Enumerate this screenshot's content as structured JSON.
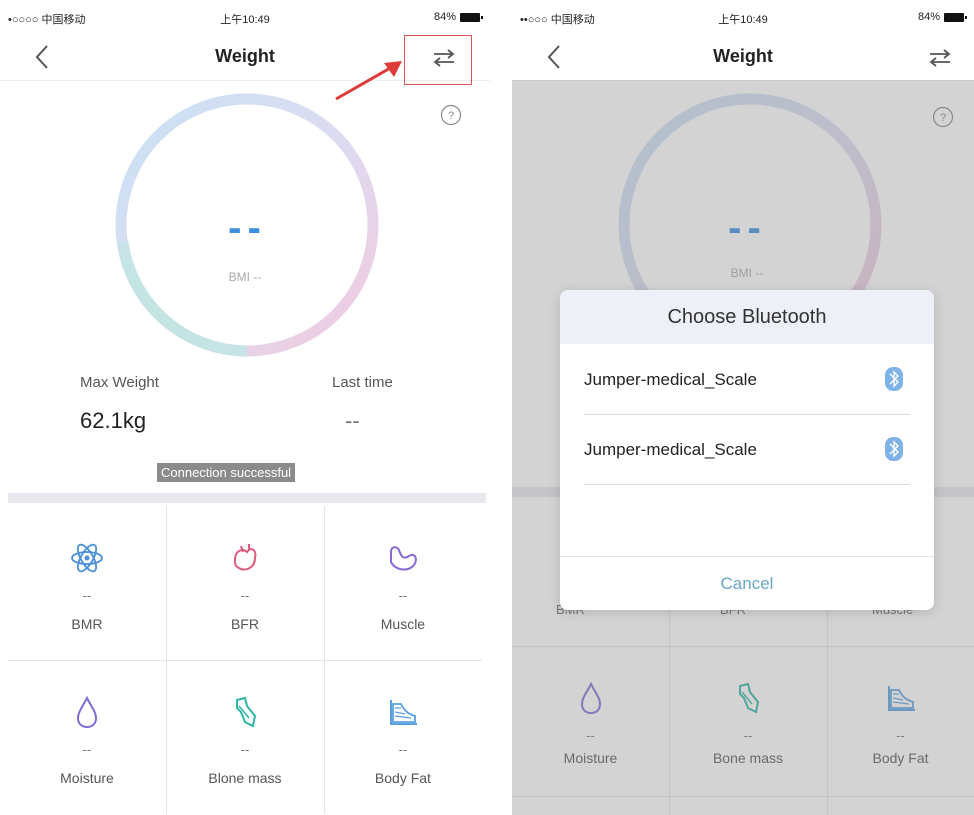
{
  "left": {
    "status": {
      "carrier": "•○○○○ 中国移动",
      "time": "上午10:49",
      "battery": "84%"
    },
    "nav": {
      "title": "Weight"
    },
    "gauge": {
      "value": "--",
      "bmi": "BMI --"
    },
    "stats": {
      "max_label": "Max Weight",
      "max_value": "62.1kg",
      "last_label": "Last time",
      "last_value": "--"
    },
    "connection": "Connection successful",
    "metrics": [
      {
        "name": "BMR",
        "value": "--",
        "icon": "atom-icon",
        "color": "#4a90d9"
      },
      {
        "name": "BFR",
        "value": "--",
        "icon": "body-fat-rate-icon",
        "color": "#e25a7a"
      },
      {
        "name": "Muscle",
        "value": "--",
        "icon": "muscle-icon",
        "color": "#8a6bd6"
      },
      {
        "name": "Moisture",
        "value": "--",
        "icon": "water-drop-icon",
        "color": "#7e6fd6"
      },
      {
        "name": "Blone mass",
        "value": "--",
        "icon": "bone-icon",
        "color": "#2fb5a5"
      },
      {
        "name": "Body Fat",
        "value": "--",
        "icon": "body-fat-chart-icon",
        "color": "#5aa0e0"
      }
    ]
  },
  "right": {
    "status": {
      "carrier": "••○○○ 中国移动",
      "time": "上午10:49",
      "battery": "84%"
    },
    "nav": {
      "title": "Weight"
    },
    "gauge": {
      "value": "--",
      "bmi": "BMI --"
    },
    "dialog": {
      "title": "Choose Bluetooth",
      "devices": [
        "Jumper-medical_Scale",
        "Jumper-medical_Scale"
      ],
      "cancel": "Cancel"
    },
    "partial_labels": [
      "BMR",
      "BFR",
      "Muscle"
    ],
    "metrics": [
      {
        "name": "Moisture",
        "value": "--",
        "icon": "water-drop-icon"
      },
      {
        "name": "Bone mass",
        "value": "--",
        "icon": "bone-icon"
      },
      {
        "name": "Body Fat",
        "value": "--",
        "icon": "body-fat-chart-icon"
      }
    ]
  }
}
